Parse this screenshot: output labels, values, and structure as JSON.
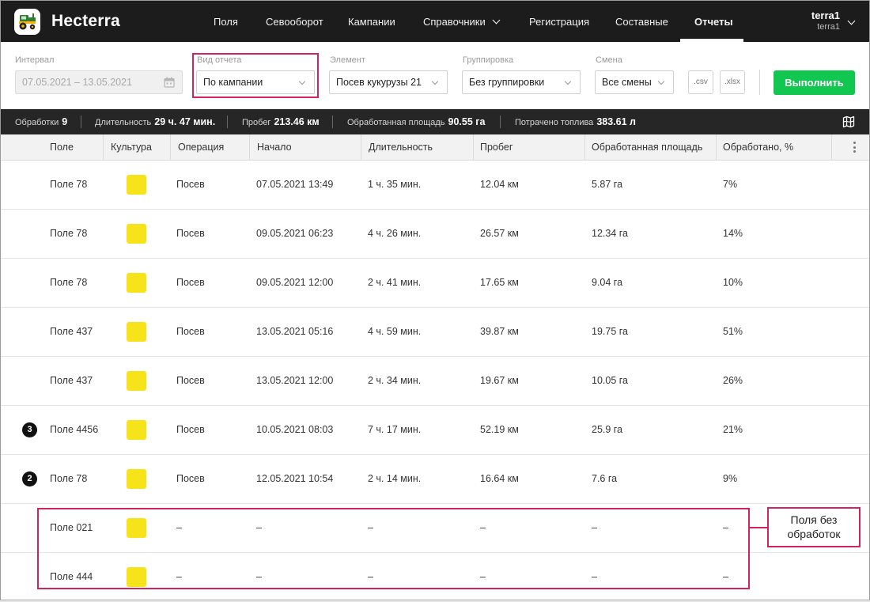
{
  "app": {
    "brand": "Hecterra"
  },
  "nav": {
    "items": [
      {
        "label": "Поля"
      },
      {
        "label": "Севооборот"
      },
      {
        "label": "Кампании"
      },
      {
        "label": "Справочники"
      },
      {
        "label": "Регистрация"
      },
      {
        "label": "Составные"
      },
      {
        "label": "Отчеты"
      }
    ],
    "active": "Отчеты"
  },
  "user": {
    "name": "terra1",
    "account": "terra1"
  },
  "filters": {
    "interval": {
      "label": "Интервал",
      "value": "07.05.2021 – 13.05.2021"
    },
    "report_type": {
      "label": "Вид отчета",
      "value": "По кампании"
    },
    "element": {
      "label": "Элемент",
      "value": "Посев кукурузы 21"
    },
    "grouping": {
      "label": "Группировка",
      "value": "Без группировки"
    },
    "shift": {
      "label": "Смена",
      "value": "Все смены"
    },
    "export_csv": ".csv",
    "export_xlsx": ".xlsx",
    "run_label": "Выполнить"
  },
  "summary": {
    "treatments": {
      "label": "Обработки",
      "value": "9"
    },
    "duration": {
      "label": "Длительность",
      "value": "29 ч. 47 мин."
    },
    "mileage": {
      "label": "Пробег",
      "value": "213.46 км"
    },
    "area": {
      "label": "Обработанная площадь",
      "value": "90.55 га"
    },
    "fuel": {
      "label": "Потрачено топлива",
      "value": "383.61 л"
    }
  },
  "table": {
    "columns": [
      "Поле",
      "Культура",
      "Операция",
      "Начало",
      "Длительность",
      "Пробег",
      "Обработанная площадь",
      "Обработано, %"
    ],
    "crop_color": "#f7e31a",
    "rows": [
      {
        "badge": "",
        "field": "Поле 78",
        "operation": "Посев",
        "start": "07.05.2021 13:49",
        "duration": "1 ч. 35 мин.",
        "mileage": "12.04 км",
        "area": "5.87 га",
        "percent": "7%"
      },
      {
        "badge": "",
        "field": "Поле 78",
        "operation": "Посев",
        "start": "09.05.2021 06:23",
        "duration": "4 ч. 26 мин.",
        "mileage": "26.57 км",
        "area": "12.34 га",
        "percent": "14%"
      },
      {
        "badge": "",
        "field": "Поле 78",
        "operation": "Посев",
        "start": "09.05.2021 12:00",
        "duration": "2 ч. 41 мин.",
        "mileage": "17.65 км",
        "area": "9.04 га",
        "percent": "10%"
      },
      {
        "badge": "",
        "field": "Поле 437",
        "operation": "Посев",
        "start": "13.05.2021 05:16",
        "duration": "4 ч. 59 мин.",
        "mileage": "39.87 км",
        "area": "19.75 га",
        "percent": "51%"
      },
      {
        "badge": "",
        "field": "Поле 437",
        "operation": "Посев",
        "start": "13.05.2021 12:00",
        "duration": "2 ч. 34 мин.",
        "mileage": "19.67 км",
        "area": "10.05 га",
        "percent": "26%"
      },
      {
        "badge": "3",
        "field": "Поле 4456",
        "operation": "Посев",
        "start": "10.05.2021 08:03",
        "duration": "7 ч. 17 мин.",
        "mileage": "52.19 км",
        "area": "25.9 га",
        "percent": "21%"
      },
      {
        "badge": "2",
        "field": "Поле  78",
        "operation": "Посев",
        "start": "12.05.2021 10:54",
        "duration": "2 ч. 14 мин.",
        "mileage": "16.64 км",
        "area": "7.6 га",
        "percent": "9%"
      },
      {
        "badge": "",
        "field": "Поле   021",
        "operation": "–",
        "start": "–",
        "duration": "–",
        "mileage": "–",
        "area": "–",
        "percent": "–"
      },
      {
        "badge": "",
        "field": "Поле   444",
        "operation": "–",
        "start": "–",
        "duration": "–",
        "mileage": "–",
        "area": "–",
        "percent": "–"
      }
    ]
  },
  "callout": {
    "line1": "Поля без",
    "line2": "обработок"
  },
  "colors": {
    "accent_green": "#12c750",
    "highlight": "#d0245a",
    "topbar": "#1c1c1c"
  }
}
